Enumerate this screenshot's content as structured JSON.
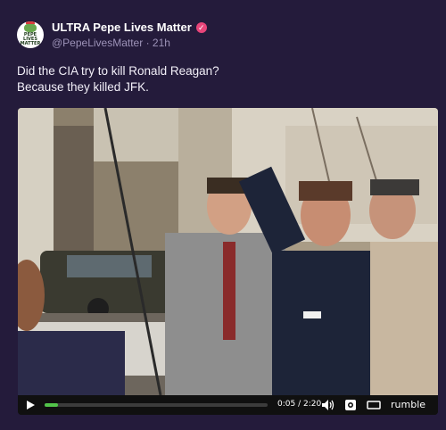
{
  "post": {
    "author": "ULTRA Pepe Lives Matter",
    "handle": "@PepeLivesMatter",
    "separator": "·",
    "time": "21h",
    "text_lines": [
      "Did the CIA try to kill Ronald Reagan?",
      "Because they killed JFK."
    ],
    "avatar_text": "PEPE\nLIVES\nMATTER",
    "verified_icon": "verified-badge-icon"
  },
  "video": {
    "current_time": "0:05",
    "duration": "2:20",
    "time_display": "0:05 / 2:20",
    "progress": 0.06,
    "brand": "rumble",
    "icons": [
      "play-icon",
      "volume-icon",
      "settings-icon",
      "theater-icon",
      "rumble-logo-icon"
    ]
  },
  "colors": {
    "background": "#241b3b",
    "verified": "#e8457a",
    "progress": "#52c44a",
    "meta_text": "#9d93b8"
  }
}
